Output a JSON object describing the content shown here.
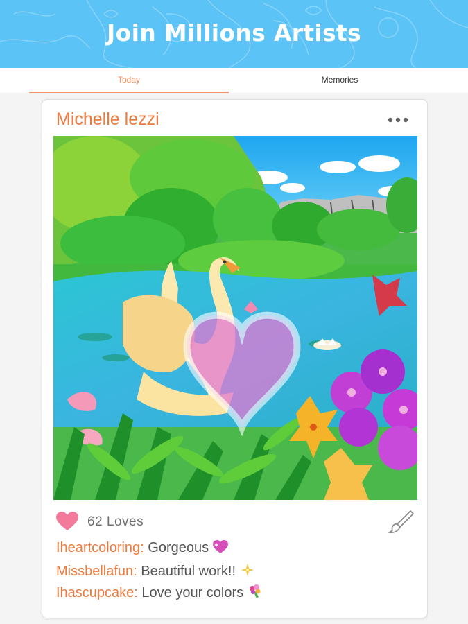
{
  "banner": {
    "title": "Join Millions Artists"
  },
  "tabs": [
    {
      "label": "Today",
      "active": true
    },
    {
      "label": "Memories",
      "active": false
    }
  ],
  "post": {
    "author": "Michelle lezzi",
    "loves_text": "62 Loves",
    "comments": [
      {
        "user": "Iheartcoloring:",
        "text": " Gorgeous",
        "emoji": "sparkling-heart-icon"
      },
      {
        "user": "Missbellafun:",
        "text": " Beautiful work!!",
        "emoji": "sparkle-star-icon"
      },
      {
        "user": "Ihascupcake:",
        "text": " Love your colors",
        "emoji": "bouquet-icon"
      }
    ]
  },
  "colors": {
    "banner": "#5cc3f6",
    "accent": "#f07a3c",
    "heart": "#f47a9c"
  }
}
